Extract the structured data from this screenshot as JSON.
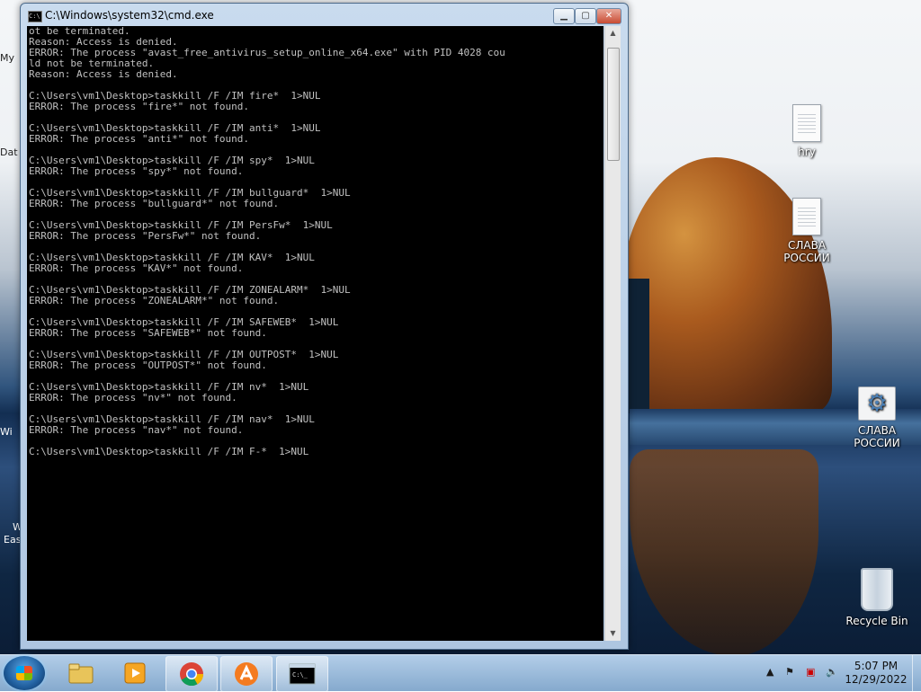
{
  "desktop": {
    "icons": [
      {
        "label": "hry"
      },
      {
        "label": "СЛАВА РОССИИ"
      },
      {
        "label": "СЛАВА РОССИИ"
      },
      {
        "label": "Recycle Bin"
      }
    ],
    "left_fragments": [
      "My",
      "Dat",
      "Wi",
      "W",
      "Eas"
    ]
  },
  "cmd": {
    "title": "C:\\Windows\\system32\\cmd.exe",
    "lines": [
      "ot be terminated.",
      "Reason: Access is denied.",
      "ERROR: The process \"avast_free_antivirus_setup_online_x64.exe\" with PID 4028 cou",
      "ld not be terminated.",
      "Reason: Access is denied.",
      "",
      "C:\\Users\\vm1\\Desktop>taskkill /F /IM fire*  1>NUL",
      "ERROR: The process \"fire*\" not found.",
      "",
      "C:\\Users\\vm1\\Desktop>taskkill /F /IM anti*  1>NUL",
      "ERROR: The process \"anti*\" not found.",
      "",
      "C:\\Users\\vm1\\Desktop>taskkill /F /IM spy*  1>NUL",
      "ERROR: The process \"spy*\" not found.",
      "",
      "C:\\Users\\vm1\\Desktop>taskkill /F /IM bullguard*  1>NUL",
      "ERROR: The process \"bullguard*\" not found.",
      "",
      "C:\\Users\\vm1\\Desktop>taskkill /F /IM PersFw*  1>NUL",
      "ERROR: The process \"PersFw*\" not found.",
      "",
      "C:\\Users\\vm1\\Desktop>taskkill /F /IM KAV*  1>NUL",
      "ERROR: The process \"KAV*\" not found.",
      "",
      "C:\\Users\\vm1\\Desktop>taskkill /F /IM ZONEALARM*  1>NUL",
      "ERROR: The process \"ZONEALARM*\" not found.",
      "",
      "C:\\Users\\vm1\\Desktop>taskkill /F /IM SAFEWEB*  1>NUL",
      "ERROR: The process \"SAFEWEB*\" not found.",
      "",
      "C:\\Users\\vm1\\Desktop>taskkill /F /IM OUTPOST*  1>NUL",
      "ERROR: The process \"OUTPOST*\" not found.",
      "",
      "C:\\Users\\vm1\\Desktop>taskkill /F /IM nv*  1>NUL",
      "ERROR: The process \"nv*\" not found.",
      "",
      "C:\\Users\\vm1\\Desktop>taskkill /F /IM nav*  1>NUL",
      "ERROR: The process \"nav*\" not found.",
      "",
      "C:\\Users\\vm1\\Desktop>taskkill /F /IM F-*  1>NUL"
    ]
  },
  "taskbar": {
    "time": "5:07 PM",
    "date": "12/29/2022",
    "apps": [
      "windows-explorer-icon",
      "media-player-icon",
      "chrome-icon",
      "avast-icon",
      "cmd-icon"
    ]
  }
}
